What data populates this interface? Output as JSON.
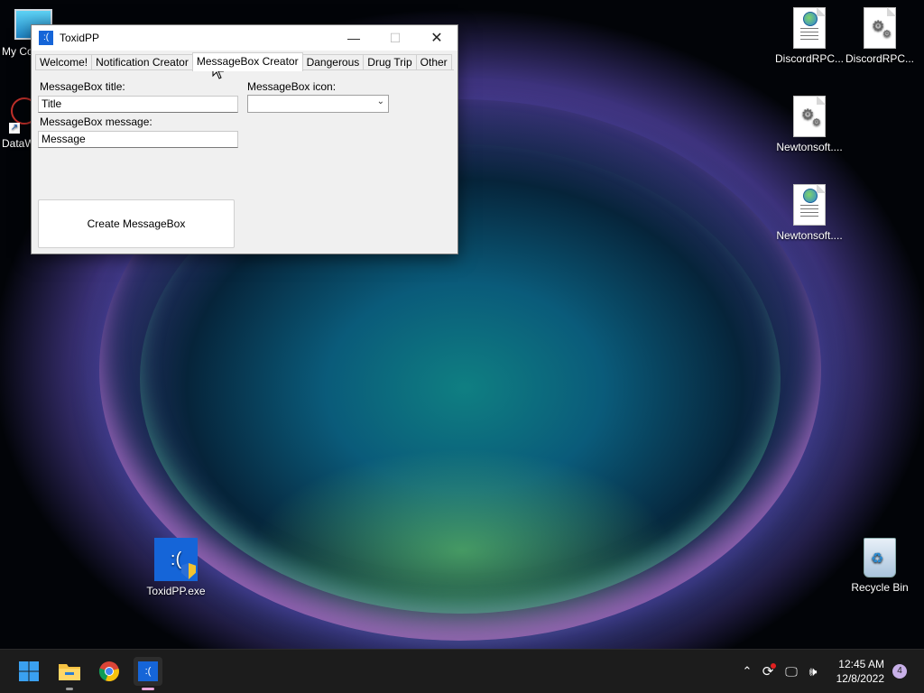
{
  "desktop": {
    "left_icons": [
      {
        "label": "My Co"
      },
      {
        "label": "DataW"
      }
    ],
    "right_icons": [
      {
        "label": "DiscordRPC...",
        "icon": "web-document-icon"
      },
      {
        "label": "DiscordRPC...",
        "icon": "settings-file-icon"
      },
      {
        "label": "Newtonsoft....",
        "icon": "settings-file-icon"
      },
      {
        "label": "Newtonsoft....",
        "icon": "web-document-icon"
      }
    ],
    "toxid_icon": {
      "label": "ToxidPP.exe",
      "glyph": ":("
    },
    "recycle_bin": {
      "label": "Recycle Bin"
    }
  },
  "window": {
    "title": "ToxidPP",
    "app_glyph": ":(",
    "controls": {
      "minimize": "—",
      "maximize": "☐",
      "close": "✕"
    },
    "tabs": [
      {
        "label": "Welcome!",
        "active": false
      },
      {
        "label": "Notification Creator",
        "active": false
      },
      {
        "label": "MessageBox Creator",
        "active": true
      },
      {
        "label": "Dangerous",
        "active": false
      },
      {
        "label": "Drug Trip",
        "active": false
      },
      {
        "label": "Other",
        "active": false
      }
    ],
    "form": {
      "title_label": "MessageBox title:",
      "title_value": "Title",
      "message_label": "MessageBox message:",
      "message_value": "Message",
      "icon_label": "MessageBox icon:",
      "icon_value": "",
      "create_button": "Create MessageBox"
    }
  },
  "taskbar": {
    "pinned": [
      "windows-start-icon",
      "file-explorer-icon",
      "chrome-icon",
      "toxidpp-icon"
    ],
    "tray_icons": [
      "chevron-up-icon",
      "sync-icon",
      "network-icon",
      "volume-icon"
    ],
    "time": "12:45 AM",
    "date": "12/8/2022",
    "notification_count": "4"
  }
}
